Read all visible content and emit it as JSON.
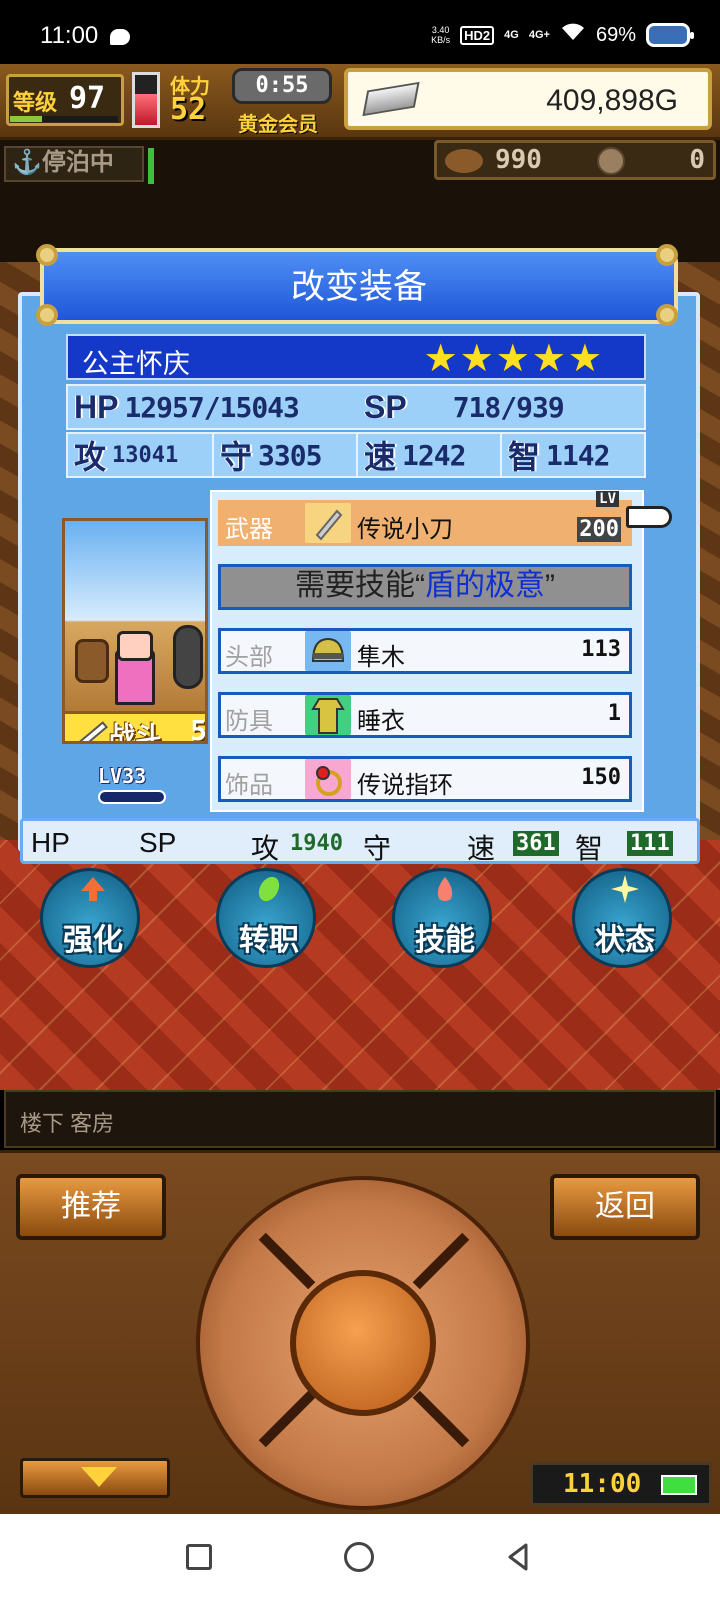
{
  "status_bar": {
    "time": "11:00",
    "net_speed": "3.40\nKB/s",
    "hd": "HD2",
    "sig1": "4G",
    "sig2": "4G+",
    "battery": "69%"
  },
  "hud": {
    "level_label": "等级",
    "level": "97",
    "stamina_label": "体力",
    "stamina": "52",
    "timer": "0:55",
    "membership": "黄金会员",
    "gold": "409,898G",
    "anchor_status": "停泊中",
    "resource_a": "990",
    "resource_b": "0",
    "energy_fraction": 0.62
  },
  "dialog": {
    "title": "改变装备",
    "character": {
      "name": "公主怀庆",
      "stars": "★★★★★",
      "hp_label": "HP",
      "hp": "12957/15043",
      "sp_label": "SP",
      "sp": "718/939",
      "atk_label": "攻",
      "atk": "13041",
      "def_label": "守",
      "def": "3305",
      "spd_label": "速",
      "spd": "1242",
      "int_label": "智",
      "int": "1142",
      "battle_label": "战斗",
      "battle_value": "5",
      "level_tag": "LV33"
    },
    "equipment": {
      "weapon": {
        "slot": "武器",
        "name": "传说小刀",
        "lv_label": "LV",
        "lv": "200"
      },
      "skill_required_prefix": "需要技能“",
      "skill_required_name": "盾的极意",
      "skill_required_suffix": "”",
      "head": {
        "slot": "头部",
        "name": "隼木",
        "value": "113"
      },
      "armor": {
        "slot": "防具",
        "name": "睡衣",
        "value": "1"
      },
      "accessory": {
        "slot": "饰品",
        "name": "传说指环",
        "value": "150"
      }
    },
    "compare": {
      "hp": "HP",
      "sp": "SP",
      "atk": "攻",
      "atk_val": "1940",
      "def": "守",
      "spd": "速",
      "spd_val": "361",
      "int": "智",
      "int_val": "111"
    }
  },
  "actions": [
    {
      "label": "强化"
    },
    {
      "label": "转职"
    },
    {
      "label": "技能"
    },
    {
      "label": "状态"
    }
  ],
  "location": "楼下 客房",
  "controls": {
    "recommend": "推荐",
    "back": "返回",
    "clock": "11:00"
  },
  "colors": {
    "dialog_blue": "#5ea6e6",
    "title_blue": "#1f56d8",
    "selected_row": "#f0b070",
    "skill_highlight": "#1030d0"
  }
}
